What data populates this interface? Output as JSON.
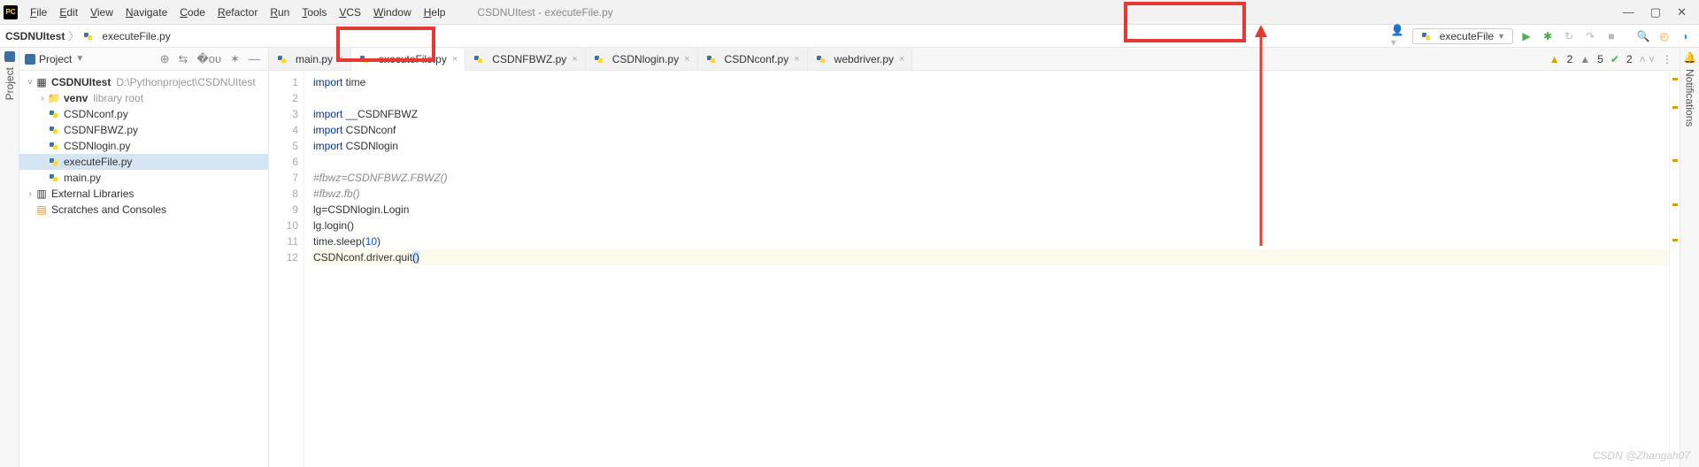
{
  "window": {
    "title": "CSDNUItest - executeFile.py",
    "menus": [
      "File",
      "Edit",
      "View",
      "Navigate",
      "Code",
      "Refactor",
      "Run",
      "Tools",
      "VCS",
      "Window",
      "Help"
    ]
  },
  "breadcrumb": {
    "project": "CSDNUItest",
    "file": "executeFile.py"
  },
  "run": {
    "config_label": "executeFile"
  },
  "project_panel": {
    "title": "Project",
    "root": {
      "name": "CSDNUItest",
      "path": "D:\\Pythonproject\\CSDNUItest"
    },
    "venv": {
      "name": "venv",
      "note": "library root"
    },
    "files": [
      "CSDNconf.py",
      "CSDNFBWZ.py",
      "CSDNlogin.py",
      "executeFile.py",
      "main.py"
    ],
    "ext_lib": "External Libraries",
    "scratch": "Scratches and Consoles"
  },
  "tabs": [
    {
      "label": "main.py",
      "active": false
    },
    {
      "label": "executeFile.py",
      "active": true
    },
    {
      "label": "CSDNFBWZ.py",
      "active": false
    },
    {
      "label": "CSDNlogin.py",
      "active": false
    },
    {
      "label": "CSDNconf.py",
      "active": false
    },
    {
      "label": "webdriver.py",
      "active": false
    }
  ],
  "inspections": {
    "warn_a": "2",
    "warn_b": "5",
    "ok": "2"
  },
  "code": {
    "lines": [
      {
        "n": 1,
        "html": "<span class='kw'>import</span> time"
      },
      {
        "n": 2,
        "html": ""
      },
      {
        "n": 3,
        "html": "<span class='kw'>import</span> __CSDNFBWZ"
      },
      {
        "n": 4,
        "html": "<span class='kw'>import</span> CSDNconf"
      },
      {
        "n": 5,
        "html": "<span class='kw'>import</span> CSDNlogin"
      },
      {
        "n": 6,
        "html": ""
      },
      {
        "n": 7,
        "html": "<span class='cm'>#fbwz=CSDNFBWZ.FBWZ()</span>"
      },
      {
        "n": 8,
        "html": "<span class='cm'>#fbwz.fb()</span>"
      },
      {
        "n": 9,
        "html": "lg=CSDNlogin.Login"
      },
      {
        "n": 10,
        "html": "lg.login()"
      },
      {
        "n": 11,
        "html": "time.sleep(<span class='num'>10</span>)"
      },
      {
        "n": 12,
        "html": "CSDNconf.driver.quit<span class='caret-hl'>()</span>",
        "current": true
      }
    ]
  },
  "right_panel": "Notifications",
  "left_panel": "Project",
  "watermark": "CSDN @Zhangah07"
}
